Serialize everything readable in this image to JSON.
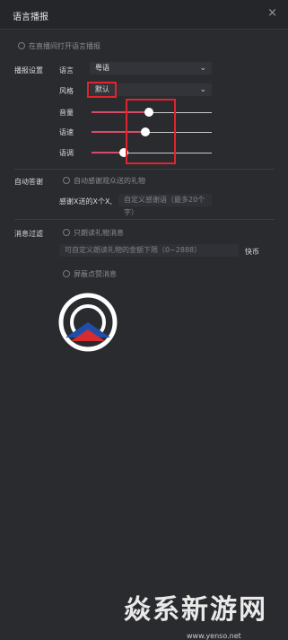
{
  "dialog": {
    "title": "语言播报",
    "close_glyph": "×"
  },
  "sections": {
    "toggle_voice_broadcast": {
      "label": "在直播间打开语言播报"
    },
    "broadcast_settings": {
      "title": "播报设置",
      "language": {
        "label": "语言",
        "value": "粤语"
      },
      "style": {
        "label": "风格",
        "value": "默认"
      },
      "sliders": [
        {
          "label": "音量",
          "level": 0.48
        },
        {
          "label": "语速",
          "level": 0.45
        },
        {
          "label": "语调",
          "level": 0.27
        }
      ]
    },
    "auto_reply": {
      "title": "自动答谢",
      "option": "自动感谢观众送的礼物",
      "template_label": "感谢X送的X个X,",
      "template_placeholder": "自定义感谢语（最多20个字）"
    },
    "message_filter": {
      "title": "消息过滤",
      "option_1": "只朗读礼物消息",
      "input_placeholder": "可自定义朗读礼物的金额下限（0~2888）",
      "unit": "快币",
      "option_2": "屏蔽点赞消息"
    }
  },
  "watermark": {
    "brand": "焱系新游网",
    "url": "www.yenso.net"
  },
  "colors": {
    "accent": "#d64c66",
    "highlight_box": "#e0242d"
  }
}
